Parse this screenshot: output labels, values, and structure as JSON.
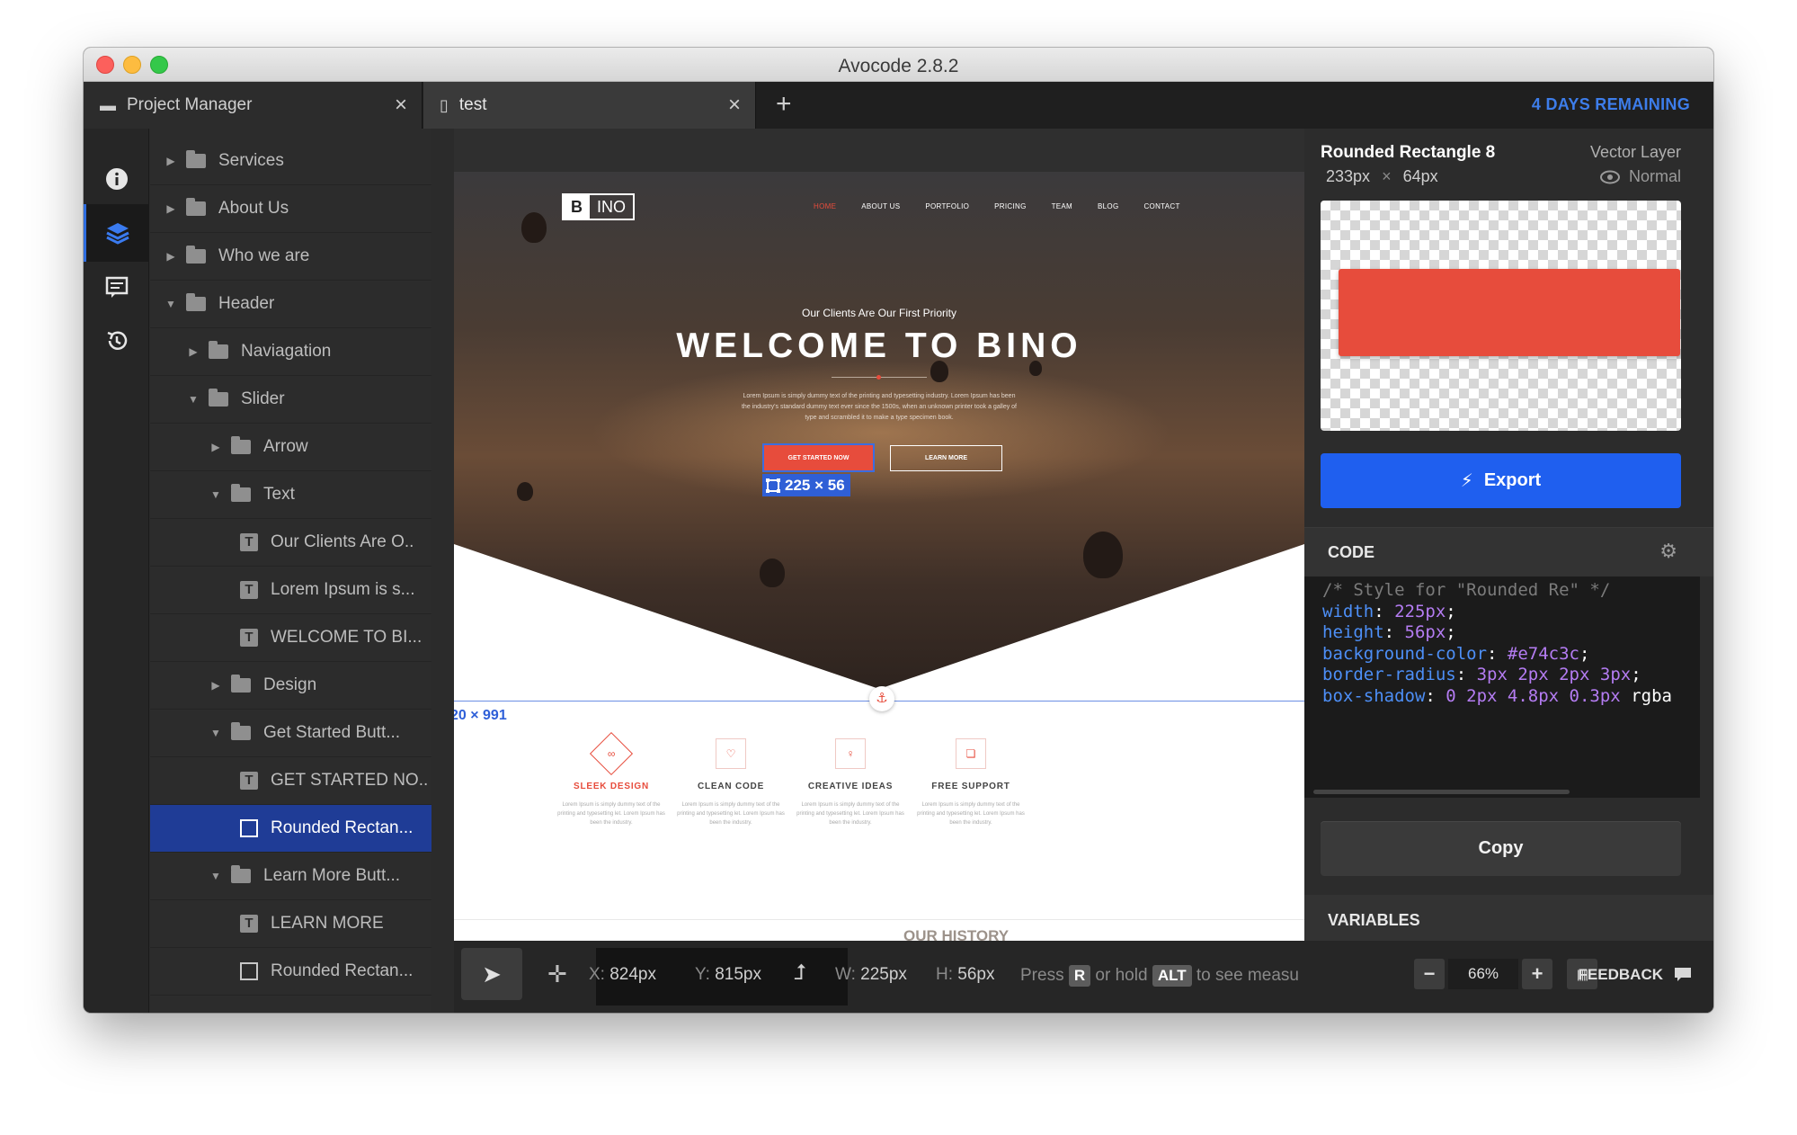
{
  "window": {
    "title": "Avocode 2.8.2"
  },
  "tabs": [
    {
      "label": "Project Manager"
    },
    {
      "label": "test"
    }
  ],
  "trial": {
    "text": "4 DAYS REMAINING"
  },
  "layers": [
    {
      "label": "Services"
    },
    {
      "label": "About Us"
    },
    {
      "label": "Who we are"
    },
    {
      "label": "Header"
    },
    {
      "label": "Naviagation"
    },
    {
      "label": "Slider"
    },
    {
      "label": "Arrow"
    },
    {
      "label": "Text"
    },
    {
      "label": "Our Clients Are O.."
    },
    {
      "label": "Lorem Ipsum is s..."
    },
    {
      "label": "WELCOME TO BI..."
    },
    {
      "label": "Design"
    },
    {
      "label": "Get Started Butt..."
    },
    {
      "label": "GET STARTED NO.."
    },
    {
      "label": "Rounded Rectan..."
    },
    {
      "label": "Learn More Butt..."
    },
    {
      "label": "LEARN MORE"
    },
    {
      "label": "Rounded Rectan..."
    }
  ],
  "design": {
    "logo_b": "B",
    "logo_ino": "INO",
    "nav": [
      "HOME",
      "ABOUT US",
      "PORTFOLIO",
      "PRICING",
      "TEAM",
      "BLOG",
      "CONTACT"
    ],
    "hero_subtitle": "Our Clients Are Our First Priority",
    "hero_title": "WELCOME TO BINO",
    "hero_text": "Lorem Ipsum is simply dummy text of the printing and typesetting industry. Lorem Ipsum has been the industry's standard dummy text ever since the 1500s, when an unknown printer took a galley of type and scrambled it to make a type specimen book.",
    "btn_get_started": "GET STARTED NOW",
    "btn_learn_more": "LEARN MORE",
    "selection_dims": "225 × 56",
    "guide_dims": "20 × 991",
    "features": [
      {
        "title": "SLEEK DESIGN",
        "text": "Lorem Ipsum is simply dummy text of the printing and typesetting let. Lorem Ipsum has been the industry."
      },
      {
        "title": "CLEAN CODE",
        "text": "Lorem Ipsum is simply dummy text of the printing and typesetting let. Lorem Ipsum has been the industry."
      },
      {
        "title": "CREATIVE IDEAS",
        "text": "Lorem Ipsum is simply dummy text of the printing and typesetting let. Lorem Ipsum has been the industry."
      },
      {
        "title": "FREE SUPPORT",
        "text": "Lorem Ipsum is simply dummy text of the printing and typesetting let. Lorem Ipsum has been the industry."
      }
    ],
    "history_title": "OUR HISTORY"
  },
  "statusbar": {
    "x_label": "X:",
    "x_value": "824px",
    "y_label": "Y:",
    "y_value": "815px",
    "w_label": "W:",
    "w_value": "225px",
    "h_label": "H:",
    "h_value": "56px",
    "press": "Press",
    "key_r": "R",
    "or_hold": "or hold",
    "key_alt": "ALT",
    "to_see": "to see measu"
  },
  "inspector": {
    "layer_name": "Rounded Rectangle 8",
    "layer_type": "Vector Layer",
    "size_w": "233px",
    "size_x": "×",
    "size_h": "64px",
    "blend": "Normal",
    "export_label": "Export",
    "code_title": "CODE",
    "code": {
      "comment": "/* Style for \"Rounded Re\" */",
      "lines": [
        {
          "prop": "width",
          "val": "225px",
          "end": ";"
        },
        {
          "prop": "height",
          "val": "56px",
          "end": ";"
        },
        {
          "prop": "background-color",
          "val": "#e74c3c",
          "end": ";"
        },
        {
          "prop": "border-radius",
          "val": "3px 2px 2px 3px",
          "end": ";"
        },
        {
          "prop": "box-shadow",
          "val": "0 2px 4.8px 0.3px",
          "end": " rgba"
        }
      ]
    },
    "copy_label": "Copy",
    "variables_title": "VARIABLES",
    "preview_color": "#e74c3c"
  },
  "zoom": {
    "minus": "−",
    "value": "66%",
    "plus": "+"
  },
  "feedback": {
    "label": "FEEDBACK"
  },
  "colors": {
    "accent": "#2f5fd6",
    "brand_red": "#e74c3c",
    "trial_blue": "#3d7dea"
  }
}
